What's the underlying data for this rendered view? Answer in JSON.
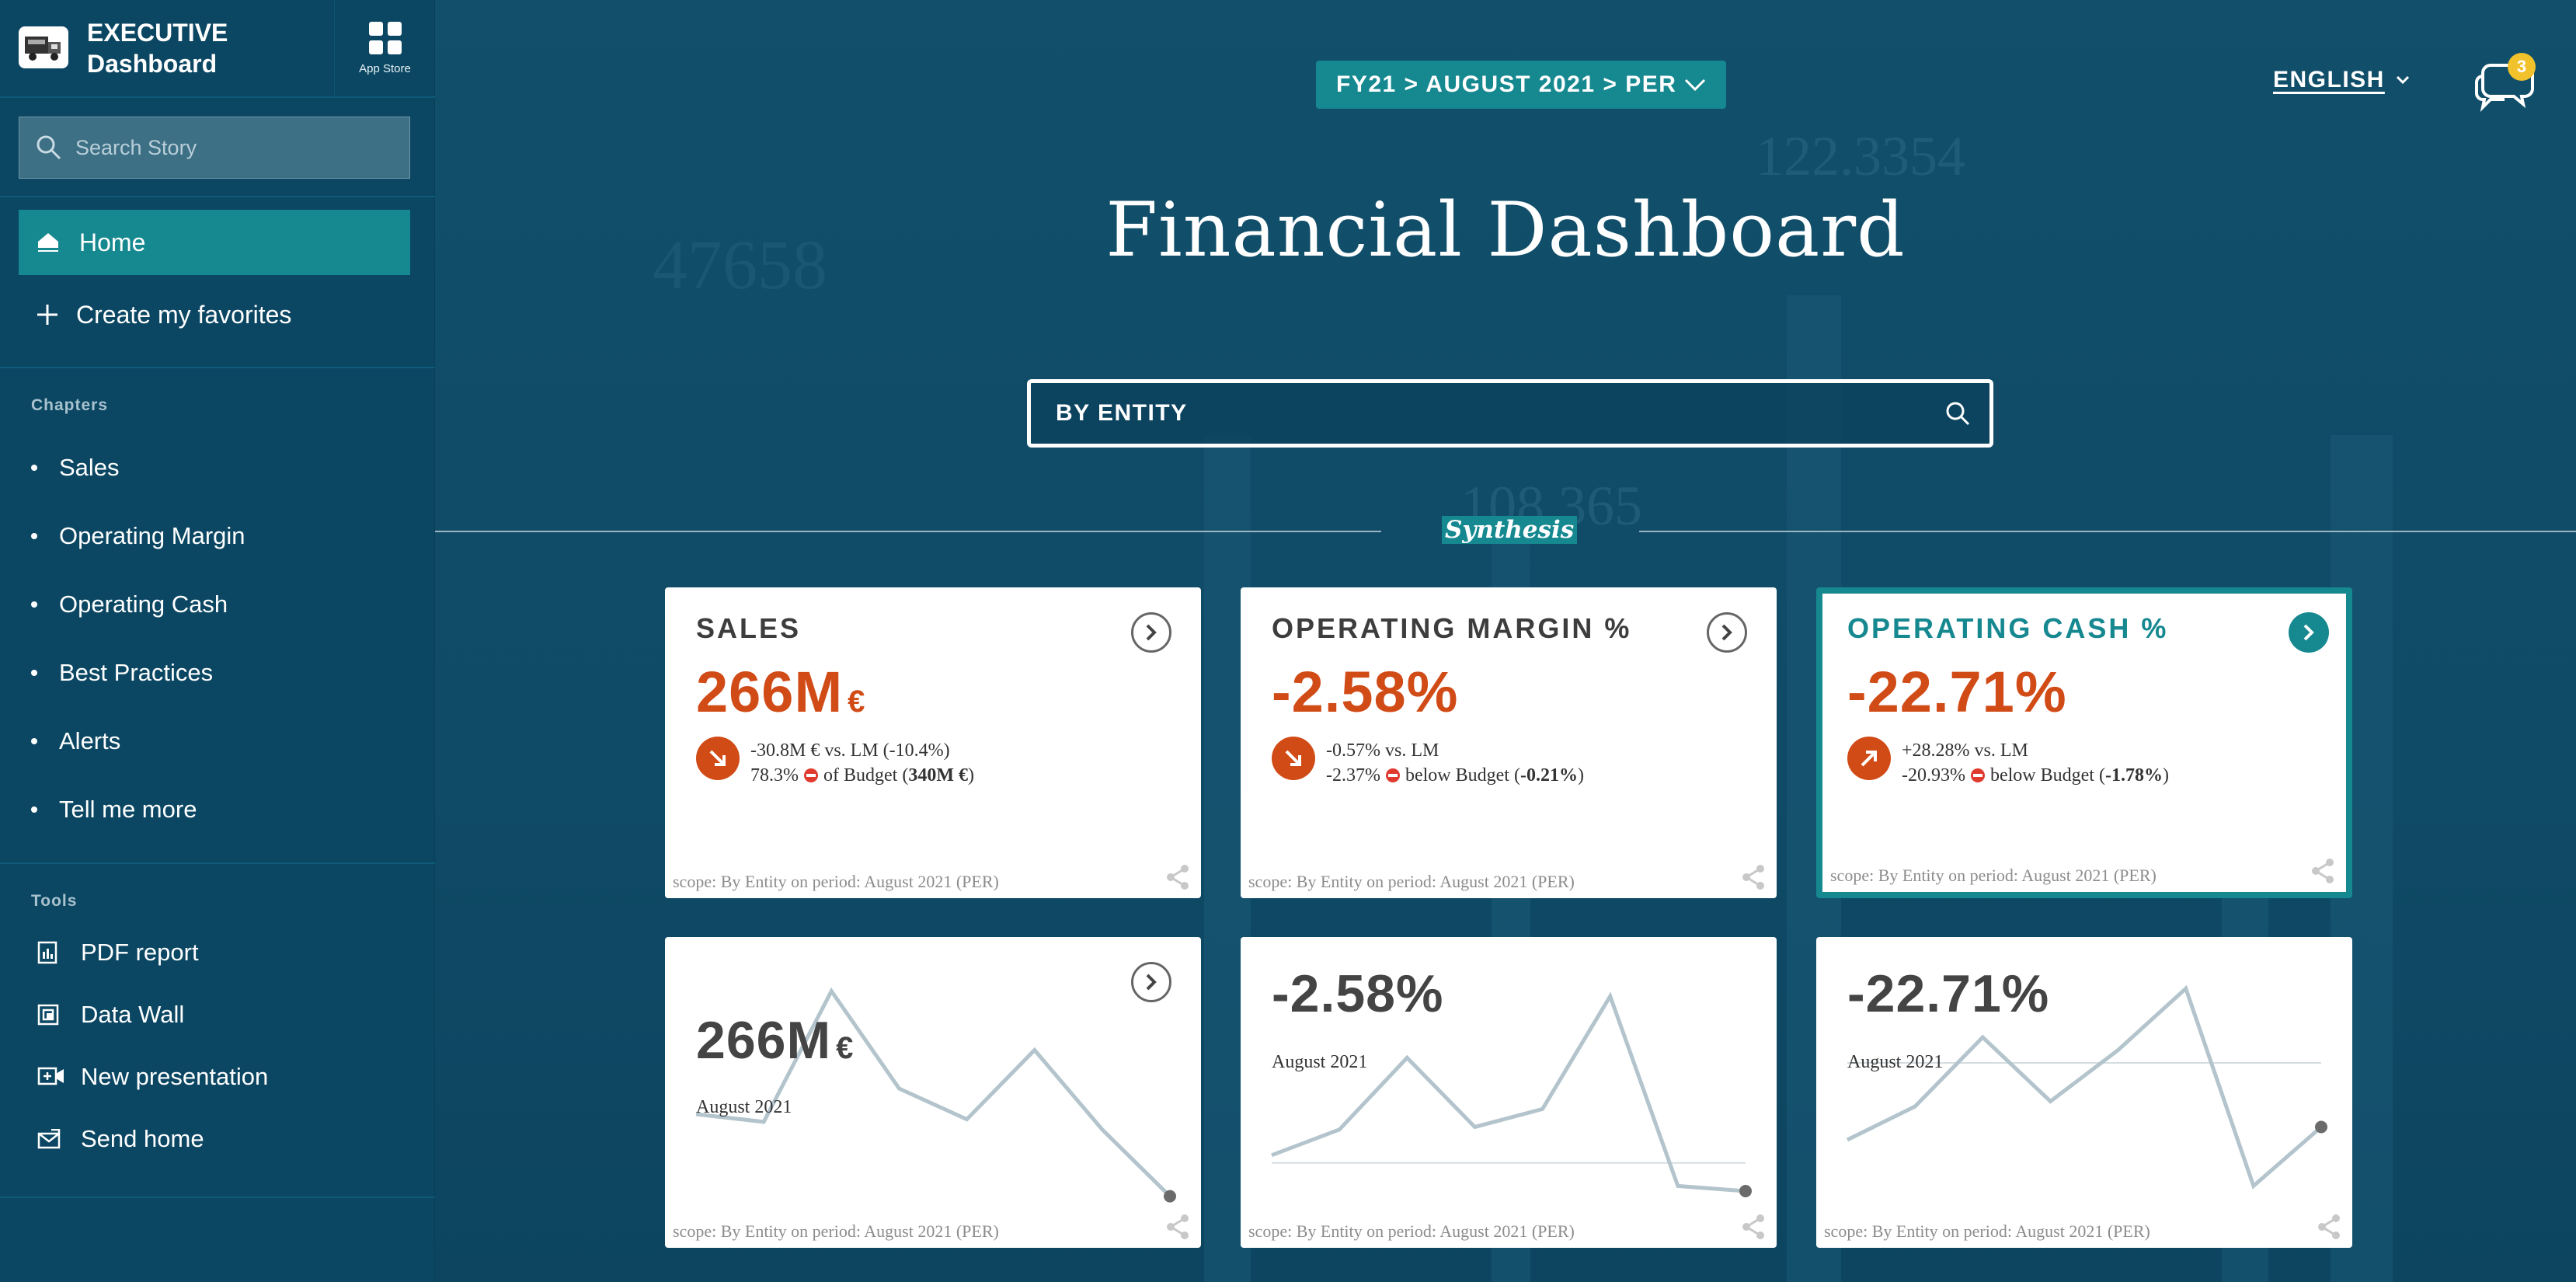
{
  "app": {
    "brand_line1": "EXECUTIVE",
    "brand_line2": "Dashboard",
    "appstore_label": "App Store"
  },
  "search": {
    "placeholder": "Search Story"
  },
  "nav": {
    "home": "Home",
    "favorites": "Create my favorites"
  },
  "chapters": {
    "heading": "Chapters",
    "items": [
      "Sales",
      "Operating Margin",
      "Operating Cash",
      "Best Practices",
      "Alerts",
      "Tell me more"
    ]
  },
  "tools": {
    "heading": "Tools",
    "items": [
      "PDF report",
      "Data Wall",
      "New presentation",
      "Send home"
    ]
  },
  "header": {
    "breadcrumb": "FY21 > AUGUST 2021 > PER",
    "language": "ENGLISH",
    "notifications": "3"
  },
  "page": {
    "title": "Financial Dashboard",
    "entity": "BY ENTITY",
    "section": "Synthesis"
  },
  "background_numbers": [
    "122.3354",
    "108.365",
    "47658"
  ],
  "colors": {
    "accent": "#168890",
    "negative": "#d14b17",
    "sidebar": "#0b4763",
    "badge": "#f2c22c"
  },
  "kpis": [
    {
      "title": "SALES",
      "value": "266M",
      "unit": "€",
      "trend": "down",
      "line1": "-30.8M € vs. LM (-10.4%)",
      "line2_a": "78.3%",
      "line2_b": " of Budget (",
      "line2_bold": "340M €",
      "line2_c": ")",
      "scope": "scope: By Entity on period: August 2021 (PER)"
    },
    {
      "title": "OPERATING MARGIN %",
      "value": "-2.58%",
      "unit": "",
      "trend": "down",
      "line1": "-0.57% vs. LM",
      "line2_a": "-2.37%",
      "line2_b": " below Budget (",
      "line2_bold": "-0.21%",
      "line2_c": ")",
      "scope": "scope: By Entity on period: August 2021 (PER)"
    },
    {
      "title": "OPERATING CASH %",
      "value": "-22.71%",
      "unit": "",
      "trend": "up",
      "line1": "+28.28% vs. LM",
      "line2_a": "-20.93%",
      "line2_b": " below Budget (",
      "line2_bold": "-1.78%",
      "line2_c": ")",
      "scope": "scope: By Entity on period: August 2021 (PER)"
    }
  ],
  "trends": [
    {
      "value": "266M",
      "unit": "€",
      "period": "August 2021",
      "scope": "scope: By Entity on period: August 2021 (PER)",
      "points": [
        0.4,
        0.37,
        0.88,
        0.5,
        0.38,
        0.65,
        0.34,
        0.08
      ]
    },
    {
      "value": "-2.58%",
      "unit": "",
      "period": "August 2021",
      "scope": "scope: By Entity on period: August 2021 (PER)",
      "points": [
        0.24,
        0.34,
        0.62,
        0.35,
        0.42,
        0.86,
        0.12,
        0.1
      ],
      "reference": 0.21
    },
    {
      "value": "-22.71%",
      "unit": "",
      "period": "August 2021",
      "scope": "scope: By Entity on period: August 2021 (PER)",
      "points": [
        0.3,
        0.43,
        0.7,
        0.45,
        0.65,
        0.89,
        0.12,
        0.35
      ],
      "reference": 0.6
    }
  ]
}
